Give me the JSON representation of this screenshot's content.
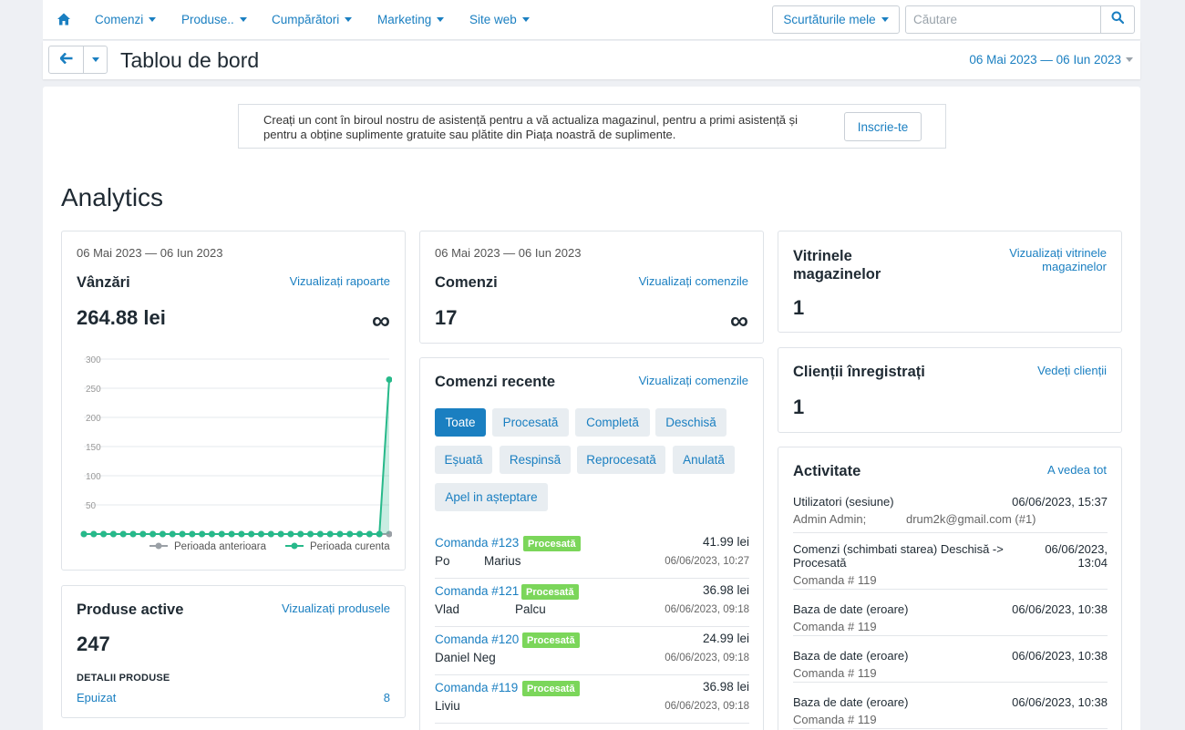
{
  "nav": {
    "items": [
      {
        "label": "Comenzi"
      },
      {
        "label": "Produse.."
      },
      {
        "label": "Cumpărători"
      },
      {
        "label": "Marketing"
      },
      {
        "label": "Site web"
      }
    ],
    "shortcuts_label": "Scurtăturile mele",
    "search_placeholder": "Căutare"
  },
  "header": {
    "title": "Tablou de bord",
    "date_range": "06 Mai 2023 — 06 Iun 2023"
  },
  "notice": {
    "text": "Creați un cont în biroul nostru de asistență pentru a vă actualiza magazinul, pentru a primi asistență și pentru a obține suplimente gratuite sau plătite din Piața noastră de suplimente.",
    "button": "Inscrie-te"
  },
  "analytics_title": "Analytics",
  "sales": {
    "period": "06 Mai 2023 — 06 Iun 2023",
    "title": "Vânzări",
    "link": "Vizualizați rapoarte",
    "value": "264.88 lei",
    "change": "∞"
  },
  "orders_stat": {
    "period": "06 Mai 2023 — 06 Iun 2023",
    "title": "Comenzi",
    "link": "Vizualizați comenzile",
    "value": "17",
    "change": "∞"
  },
  "storefronts": {
    "title": "Vitrinele magazinelor",
    "link": "Vizualizați vitrinele magazinelor",
    "value": "1"
  },
  "customers": {
    "title": "Clienții înregistrați",
    "link": "Vedeți clienții",
    "value": "1"
  },
  "products": {
    "title": "Produse active",
    "link": "Vizualizați produsele",
    "value": "247",
    "details_label": "DETALII PRODUSE",
    "details": [
      {
        "name": "Epuizat",
        "value": "8"
      }
    ]
  },
  "recent_orders": {
    "title": "Comenzi recente",
    "link": "Vizualizați comenzile",
    "tabs": [
      {
        "label": "Toate",
        "active": true
      },
      {
        "label": "Procesată"
      },
      {
        "label": "Completă"
      },
      {
        "label": "Deschisă"
      },
      {
        "label": "Eșuată"
      },
      {
        "label": "Respinsă"
      },
      {
        "label": "Reprocesată"
      },
      {
        "label": "Anulată"
      },
      {
        "label": "Apel in așteptare"
      }
    ],
    "orders": [
      {
        "id": "Comanda #123",
        "status": "Procesată",
        "amount": "41.99 lei",
        "first": "Po",
        "last": "Marius",
        "date": "06/06/2023, 10:27"
      },
      {
        "id": "Comanda #121",
        "status": "Procesată",
        "amount": "36.98 lei",
        "first": "Vlad",
        "last": "Palcu",
        "date": "06/06/2023, 09:18"
      },
      {
        "id": "Comanda #120",
        "status": "Procesată",
        "amount": "24.99 lei",
        "first": "Daniel Neg",
        "last": "",
        "date": "06/06/2023, 09:18"
      },
      {
        "id": "Comanda #119",
        "status": "Procesată",
        "amount": "36.98 lei",
        "first": "Liviu",
        "last": "",
        "date": "06/06/2023, 09:18"
      }
    ]
  },
  "activity": {
    "title": "Activitate",
    "link": "A vedea tot",
    "items": [
      {
        "title": "Utilizatori (sesiune)",
        "time": "06/06/2023, 15:37",
        "sub": "Admin Admin;",
        "sub2": "drum2k@gmail.com (#1)"
      },
      {
        "title": "Comenzi (schimbati starea) Deschisă -> Procesată",
        "time": "06/06/2023, 13:04",
        "sub": "Comanda # 119"
      },
      {
        "title": "Baza de date (eroare)",
        "time": "06/06/2023, 10:38",
        "sub": "Comanda # 119"
      },
      {
        "title": "Baza de date (eroare)",
        "time": "06/06/2023, 10:38",
        "sub": "Comanda # 119"
      },
      {
        "title": "Baza de date (eroare)",
        "time": "06/06/2023, 10:38",
        "sub": "Comanda # 119"
      }
    ]
  },
  "colors": {
    "accent": "#1a7fc1",
    "current_series": "#27b98a",
    "previous_series": "#9aa0a6",
    "badge": "#7bd65a"
  },
  "chart_data": {
    "type": "line",
    "title": "",
    "xlabel": "",
    "ylabel": "",
    "ylim": [
      0,
      300
    ],
    "yticks": [
      50,
      100,
      150,
      200,
      250,
      300
    ],
    "grid": true,
    "legend_position": "bottom-right",
    "series": [
      {
        "name": "Perioada anterioara",
        "values": [
          0,
          0,
          0,
          0,
          0,
          0,
          0,
          0,
          0,
          0,
          0,
          0,
          0,
          0,
          0,
          0,
          0,
          0,
          0,
          0,
          0,
          0,
          0,
          0,
          0,
          0,
          0,
          0,
          0,
          0,
          0,
          0
        ]
      },
      {
        "name": "Perioada curenta",
        "values": [
          0,
          0,
          0,
          0,
          0,
          0,
          0,
          0,
          0,
          0,
          0,
          0,
          0,
          0,
          0,
          0,
          0,
          0,
          0,
          0,
          0,
          0,
          0,
          0,
          0,
          0,
          0,
          0,
          0,
          0,
          0,
          264.88
        ]
      }
    ]
  }
}
